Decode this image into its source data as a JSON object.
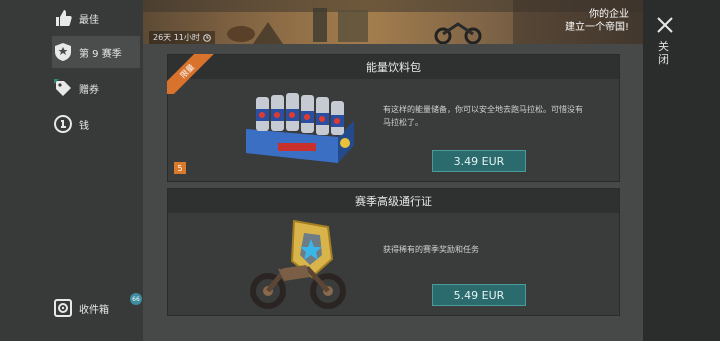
{
  "sidebar": {
    "items": [
      {
        "label": "最佳",
        "icon": "thumbs-up-icon"
      },
      {
        "label": "第 9 赛季",
        "icon": "season-shield-icon"
      },
      {
        "label": "赠券",
        "icon": "coupon-tag-icon"
      },
      {
        "label": "钱",
        "icon": "coin-icon"
      }
    ],
    "inbox": {
      "label": "收件箱",
      "icon": "inbox-icon",
      "count": "66"
    }
  },
  "banner": {
    "timer": "26天 11小时",
    "headline_line1": "你的企业",
    "headline_line2": "建立一个帝国!"
  },
  "close": {
    "label": "关闭",
    "icon": "close-icon"
  },
  "offers": [
    {
      "title": "能量饮料包",
      "ribbon": "限量",
      "quantity": "5",
      "description": "有这样的能量储备，你可以安全地去跑马拉松。可惜没有马拉松了。",
      "price": "3.49 EUR",
      "image_icon": "energy-drink-crate-icon"
    },
    {
      "title": "赛季高级通行证",
      "description": "获得稀有的赛季奖励和任务",
      "price": "5.49 EUR",
      "image_icon": "motorcycle-pass-icon"
    }
  ],
  "colors": {
    "ribbon": "#d8722d",
    "price_button": "#2b6b6d",
    "badge": "#3d8ca0"
  }
}
